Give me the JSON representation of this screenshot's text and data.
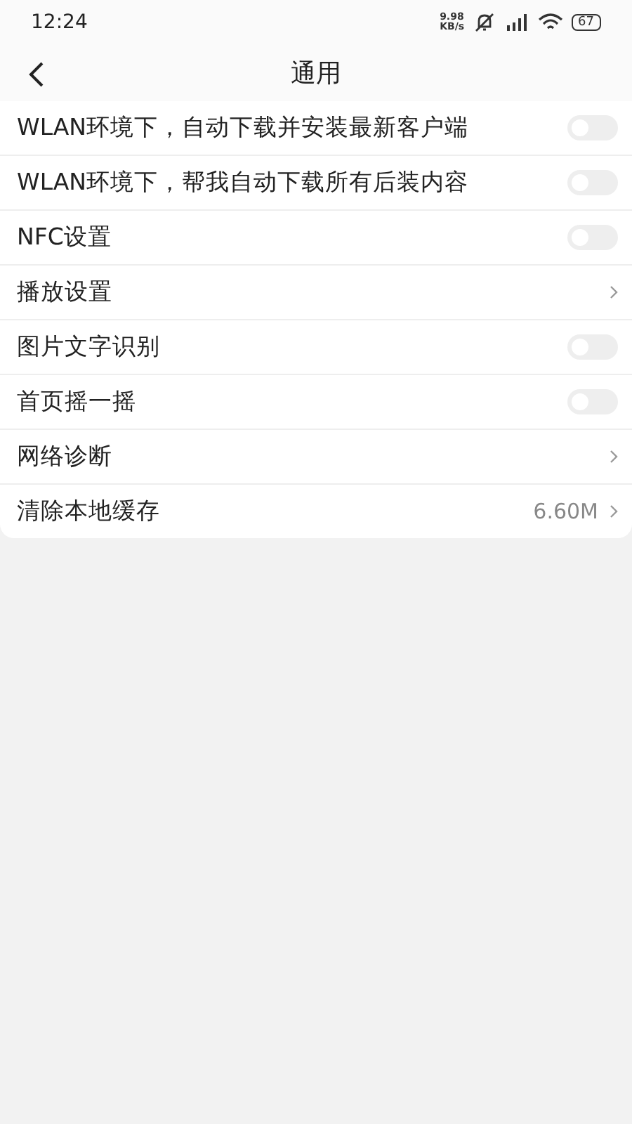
{
  "status_bar": {
    "time": "12:24",
    "speed_value": "9.98",
    "speed_unit": "KB/s",
    "battery": "67"
  },
  "header": {
    "title": "通用"
  },
  "items": [
    {
      "label": "WLAN环境下，自动下载并安装最新客户端",
      "kind": "toggle",
      "on": false
    },
    {
      "label": "WLAN环境下，帮我自动下载所有后装内容",
      "kind": "toggle",
      "on": false
    },
    {
      "label": "NFC设置",
      "kind": "toggle",
      "on": false
    },
    {
      "label": "播放设置",
      "kind": "link"
    },
    {
      "label": "图片文字识别",
      "kind": "toggle",
      "on": false
    },
    {
      "label": "首页摇一摇",
      "kind": "toggle",
      "on": false
    },
    {
      "label": "网络诊断",
      "kind": "link"
    },
    {
      "label": "清除本地缓存",
      "kind": "link",
      "value": "6.60M"
    }
  ]
}
